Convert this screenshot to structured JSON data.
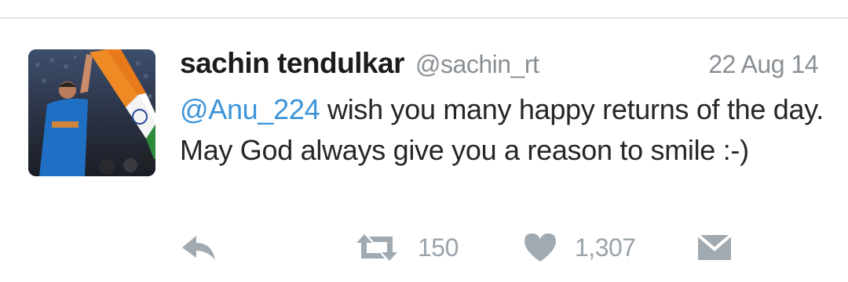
{
  "tweet": {
    "display_name": "sachin tendulkar",
    "username": "@sachin_rt",
    "timestamp": "22 Aug 14",
    "mention": "@Anu_224",
    "text": " wish you many happy returns of the day. May God always give you a reason to smile :-)"
  },
  "actions": {
    "reply_icon": "reply-arrow-icon",
    "retweet_icon": "retweet-icon",
    "retweet_count": "150",
    "like_icon": "heart-icon",
    "like_count": "1,307",
    "message_icon": "envelope-icon"
  },
  "colors": {
    "mention": "#3b94d9",
    "meta_gray": "#8a8f94",
    "action_gray": "#9aa3ab",
    "text": "#262626"
  }
}
